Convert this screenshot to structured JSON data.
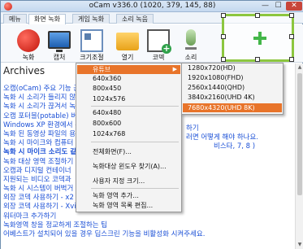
{
  "window": {
    "title": "oCam v336.0 (1020, 379, 145, 88)",
    "controls": {
      "minimize": "—",
      "maximize": "☐",
      "close": "✕"
    }
  },
  "tabs": [
    {
      "label": "메뉴"
    },
    {
      "label": "화면 녹화"
    },
    {
      "label": "게임 녹화"
    },
    {
      "label": "소리 녹음"
    }
  ],
  "toolbar": {
    "record": "녹화",
    "capture": "캡처",
    "resize": "크기조절",
    "open": "열기",
    "codec": "코덱",
    "sound": "소리"
  },
  "content": {
    "heading": "Archives",
    "lines": [
      "오캠(oCam) 주요 기능 근",
      "녹화 시 소리가 들리지 않",
      "녹화 시 소리가 끊겨서 녹",
      "오캠 포터블(potable) 버전",
      "Windows XP 환경에서 녹",
      "녹화 된 동영상 파일의 용",
      "녹화 시 마이크와 컴퓨터",
      "녹화 시 마이크 소리도 같",
      "녹화 대상 영역 조절하기",
      "오캠과 디지털 컨테이너",
      "지원되는 비디오 코덱과",
      "녹화 시 시스템이 버벅거",
      "외장 코덱 사용하기 - x2",
      "외장 코덱 사용하기 - Xvi",
      "워터마크 추가하기",
      "녹화영역 창을 정교하게 조절하는 팁",
      "어베스트가 설치되어 있을 경우 딥스크린 기능을 비활성화 시켜주세요."
    ],
    "right_fragments": [
      "하기",
      "러면 어떻게 해야 하나요.",
      "비스타, 7, 8 )"
    ]
  },
  "menu": {
    "items": [
      {
        "label": "유튜브",
        "has_submenu": true,
        "highlighted": true
      },
      {
        "label": "640x360"
      },
      {
        "label": "800x450"
      },
      {
        "label": "1024x576"
      },
      {
        "label": "640x480"
      },
      {
        "label": "800x600"
      },
      {
        "label": "1024x768"
      },
      {
        "label": "전체화면(F)..."
      },
      {
        "label": "녹화대상 윈도우 찾기(A)..."
      },
      {
        "label": "사용자 지정 크기..."
      },
      {
        "label": "녹화 영역 추가..."
      },
      {
        "label": "녹화 영역 목록 편집..."
      }
    ],
    "submenu_arrow": "▶",
    "submenu": [
      {
        "label": "1280x720(HD)"
      },
      {
        "label": "1920x1080(FHD)"
      },
      {
        "label": "2560x1440(QHD)"
      },
      {
        "label": "3840x2160(UHD 4K)"
      },
      {
        "label": "7680x4320(UHD 8K)",
        "highlighted": true
      }
    ]
  },
  "scrollbar": {
    "up": "▲",
    "down": "▼"
  },
  "colors": {
    "accent_highlight": "#e8742a",
    "capture_region": "#8cc63f",
    "link_text": "#1a4fd6"
  }
}
